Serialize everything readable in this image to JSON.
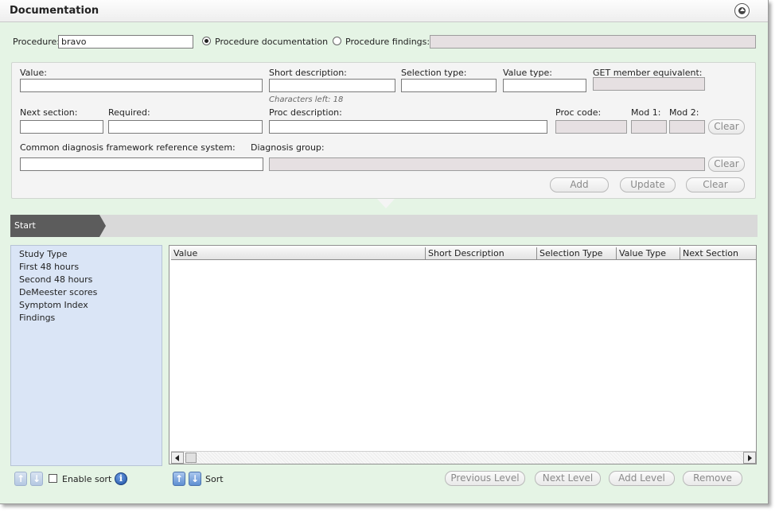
{
  "window": {
    "title": "Documentation"
  },
  "procedure": {
    "label": "Procedure:",
    "value": "bravo",
    "radio_documentation": "Procedure documentation",
    "radio_findings": "Procedure findings:",
    "selected": "Procedure documentation"
  },
  "form": {
    "value_label": "Value:",
    "short_desc_label": "Short description:",
    "chars_left": "Characters left: 18",
    "selection_type_label": "Selection type:",
    "value_type_label": "Value type:",
    "get_member_label": "GET member equivalent:",
    "next_section_label": "Next section:",
    "required_label": "Required:",
    "proc_description_label": "Proc description:",
    "proc_code_label": "Proc code:",
    "mod1_label": "Mod 1:",
    "mod2_label": "Mod 2:",
    "clear_label": "Clear",
    "cdf_label": "Common diagnosis framework reference system:",
    "diagnosis_group_label": "Diagnosis group:",
    "add_label": "Add",
    "update_label": "Update"
  },
  "breadcrumb": {
    "start": "Start"
  },
  "tree": {
    "items": [
      "Study Type",
      "First 48 hours",
      "Second 48 hours",
      "DeMeester scores",
      "Symptom Index",
      "Findings"
    ]
  },
  "grid": {
    "columns": [
      "Value",
      "Short Description",
      "Selection Type",
      "Value Type",
      "Next Section"
    ]
  },
  "footer": {
    "enable_sort": "Enable sort",
    "sort": "Sort",
    "previous_level": "Previous Level",
    "next_level": "Next Level",
    "add_level": "Add Level",
    "remove": "Remove"
  },
  "colors": {
    "window_bg": "#e5f4e5",
    "tree_bg": "#dae5f6",
    "crumb_bg": "#5c5c5c"
  }
}
